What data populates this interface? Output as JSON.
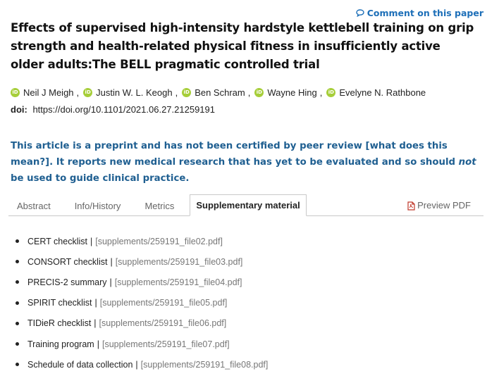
{
  "comment": {
    "label": "Comment on this paper"
  },
  "article": {
    "title": "Effects of supervised high-intensity hardstyle kettlebell training on grip strength and health-related physical fitness in insufficiently active older adults:The BELL pragmatic controlled trial",
    "authors": [
      {
        "name": "Neil J Meigh",
        "orcid_badge": "iD"
      },
      {
        "name": "Justin W. L. Keogh",
        "orcid_badge": "iD"
      },
      {
        "name": "Ben Schram",
        "orcid_badge": "iD"
      },
      {
        "name": "Wayne Hing",
        "orcid_badge": "iD"
      },
      {
        "name": "Evelyne N. Rathbone",
        "orcid_badge": "iD"
      }
    ],
    "doi_label": "doi:",
    "doi_value": "https://doi.org/10.1101/2021.06.27.21259191"
  },
  "notice": {
    "part1": "This article is a preprint and has not been certified by peer review [what does this mean?]. It reports new medical research that has yet to be evaluated and so should ",
    "emphasis": "not",
    "part2": " be used to guide clinical practice."
  },
  "tabs": [
    {
      "label": "Abstract"
    },
    {
      "label": "Info/History"
    },
    {
      "label": "Metrics"
    },
    {
      "label": "Supplementary material",
      "active": true
    }
  ],
  "preview_pdf": {
    "label": "Preview PDF"
  },
  "supplements": [
    {
      "name": "CERT checklist",
      "link": "[supplements/259191_file02.pdf]"
    },
    {
      "name": "CONSORT checklist",
      "link": "[supplements/259191_file03.pdf]"
    },
    {
      "name": "PRECIS-2 summary",
      "link": "[supplements/259191_file04.pdf]"
    },
    {
      "name": "SPIRIT checklist",
      "link": "[supplements/259191_file05.pdf]"
    },
    {
      "name": "TIDieR checklist",
      "link": "[supplements/259191_file06.pdf]"
    },
    {
      "name": "Training program",
      "link": "[supplements/259191_file07.pdf]"
    },
    {
      "name": "Schedule of data collection",
      "link": "[supplements/259191_file08.pdf]"
    }
  ],
  "colors": {
    "accent": "#1d6fb8",
    "notice": "#1f5f91",
    "orcid": "#a6ce39"
  },
  "icons": {
    "comment": "speech-bubble-icon",
    "pdf": "pdf-file-icon",
    "orcid": "orcid-icon"
  }
}
